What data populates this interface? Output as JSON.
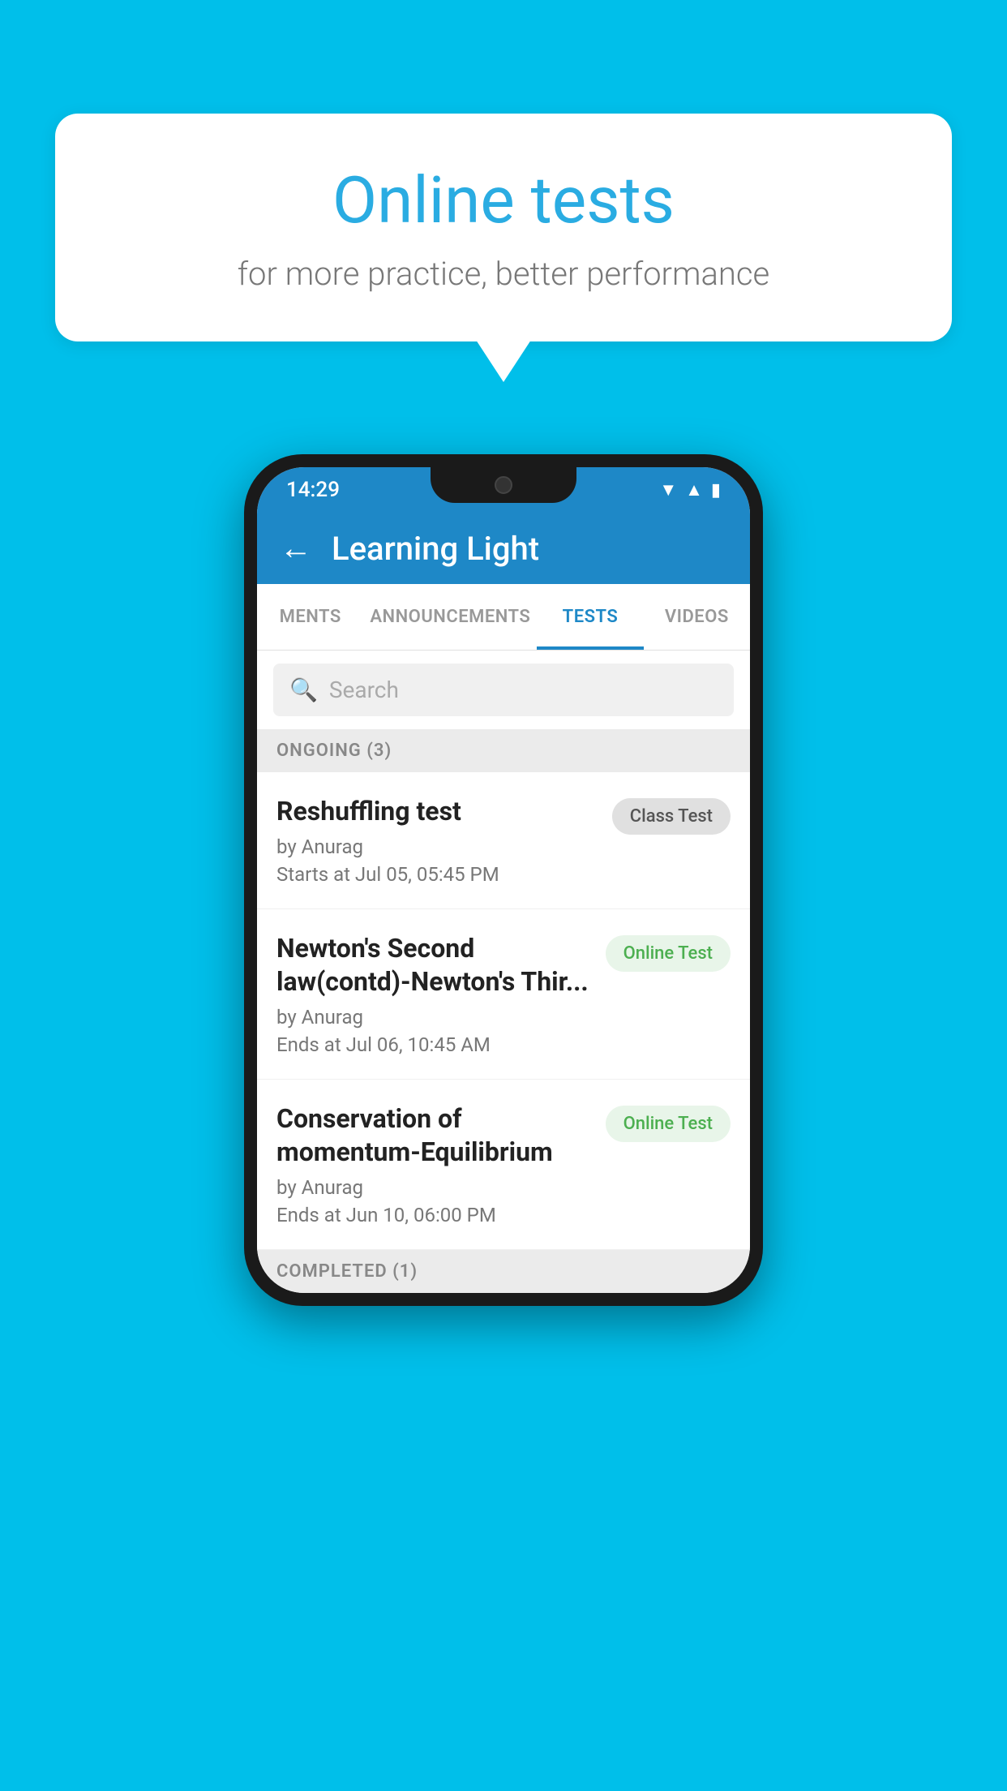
{
  "background": {
    "color": "#00BFEA"
  },
  "bubble": {
    "title": "Online tests",
    "subtitle": "for more practice, better performance"
  },
  "phone": {
    "status_bar": {
      "time": "14:29",
      "icons": [
        "wifi",
        "signal",
        "battery"
      ]
    },
    "header": {
      "title": "Learning Light",
      "back_label": "←"
    },
    "tabs": [
      {
        "label": "MENTS",
        "active": false
      },
      {
        "label": "ANNOUNCEMENTS",
        "active": false
      },
      {
        "label": "TESTS",
        "active": true
      },
      {
        "label": "VIDEOS",
        "active": false
      }
    ],
    "search": {
      "placeholder": "Search"
    },
    "ongoing_section": {
      "label": "ONGOING (3)",
      "items": [
        {
          "title": "Reshuffling test",
          "author": "by Anurag",
          "date": "Starts at  Jul 05, 05:45 PM",
          "badge": "Class Test",
          "badge_type": "class"
        },
        {
          "title": "Newton's Second law(contd)-Newton's Thir...",
          "author": "by Anurag",
          "date": "Ends at  Jul 06, 10:45 AM",
          "badge": "Online Test",
          "badge_type": "online"
        },
        {
          "title": "Conservation of momentum-Equilibrium",
          "author": "by Anurag",
          "date": "Ends at  Jun 10, 06:00 PM",
          "badge": "Online Test",
          "badge_type": "online"
        }
      ]
    },
    "completed_section": {
      "label": "COMPLETED (1)"
    }
  }
}
